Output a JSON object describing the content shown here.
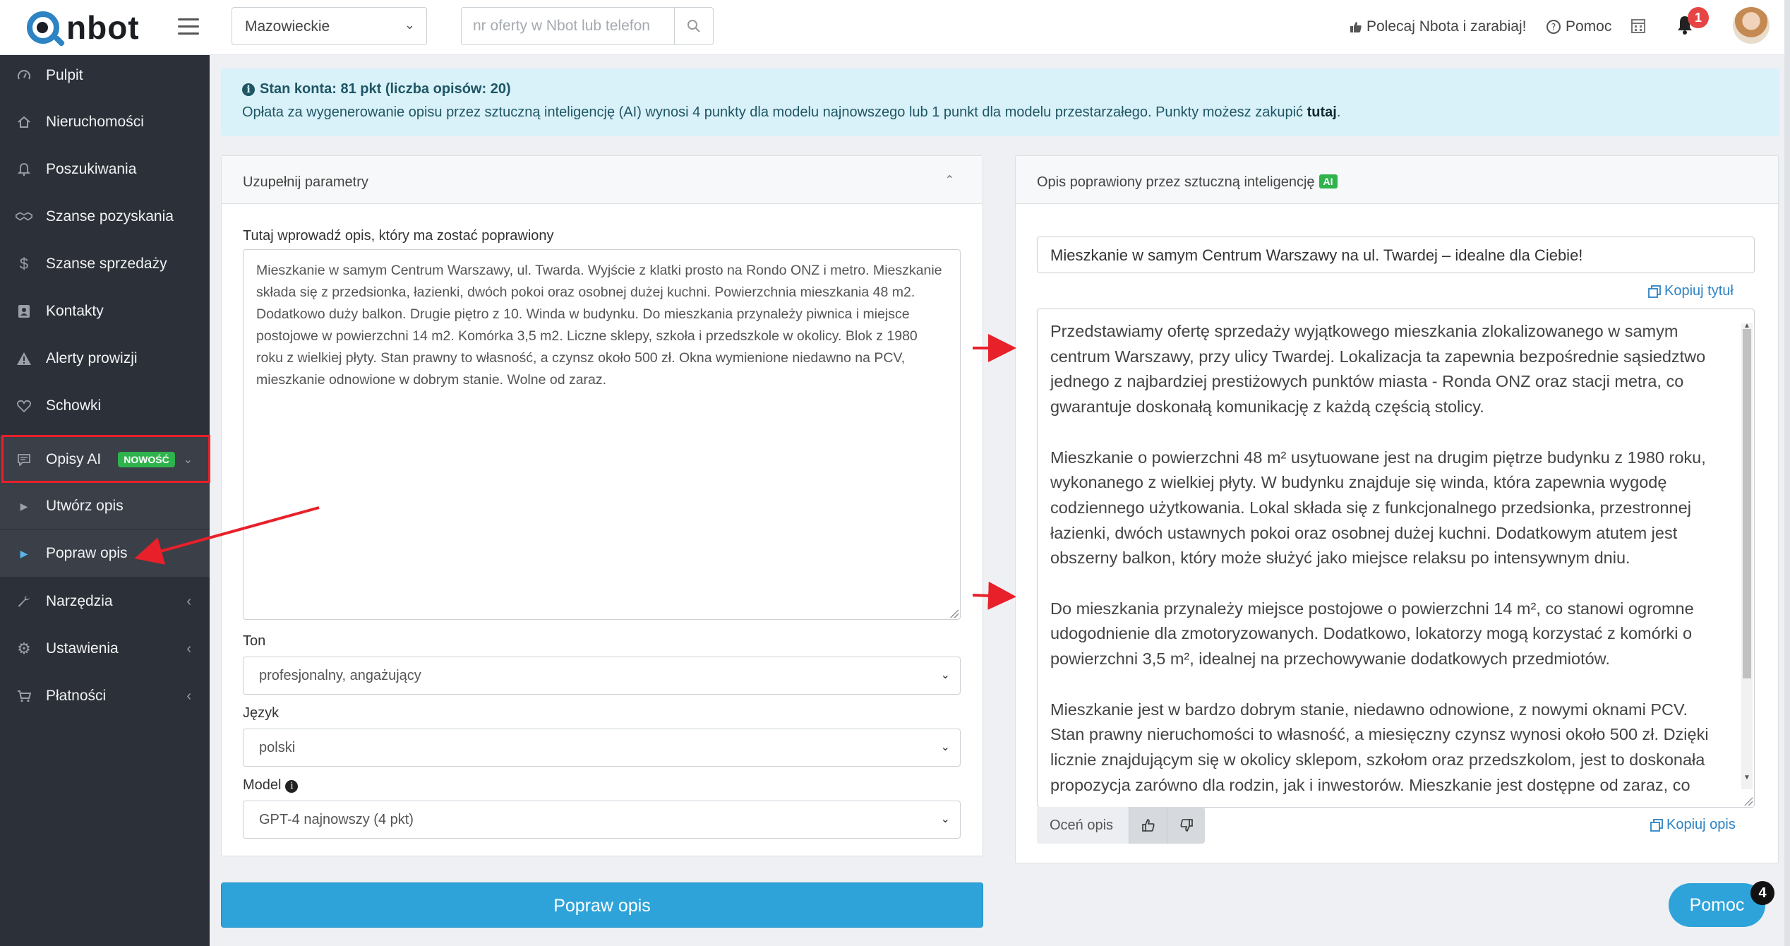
{
  "header": {
    "logo_text": "nbot",
    "region_select": "Mazowieckie",
    "search_placeholder": "nr oferty w Nbot lub telefon",
    "refer_label": "Polecaj Nbota i zarabiaj!",
    "help_label": "Pomoc",
    "notification_count": "1"
  },
  "sidebar": {
    "items": [
      {
        "label": "Pulpit",
        "icon": "dashboard-icon"
      },
      {
        "label": "Nieruchomości",
        "icon": "home-icon"
      },
      {
        "label": "Poszukiwania",
        "icon": "bell-icon"
      },
      {
        "label": "Szanse pozyskania",
        "icon": "handshake-icon"
      },
      {
        "label": "Szanse sprzedaży",
        "icon": "dollar-icon"
      },
      {
        "label": "Kontakty",
        "icon": "contact-icon"
      },
      {
        "label": "Alerty prowizji",
        "icon": "warning-icon"
      },
      {
        "label": "Schowki",
        "icon": "heart-icon"
      },
      {
        "label": "Opisy AI",
        "icon": "comment-icon",
        "badge": "NOWOŚĆ"
      },
      {
        "label": "Utwórz opis",
        "icon": "caret-right-icon"
      },
      {
        "label": "Popraw opis",
        "icon": "caret-right-icon"
      },
      {
        "label": "Narzędzia",
        "icon": "wrench-icon"
      },
      {
        "label": "Ustawienia",
        "icon": "cog-icon"
      },
      {
        "label": "Płatności",
        "icon": "cart-icon"
      }
    ]
  },
  "banner": {
    "title": "Stan konta: 81 pkt (liczba opisów: 20)",
    "text": "Opłata za wygenerowanie opisu przez sztuczną inteligencję (AI) wynosi 4 punkty dla modelu najnowszego lub 1 punkt dla modelu przestarzałego. Punkty możesz zakupić ",
    "link": "tutaj",
    "end": "."
  },
  "left_panel": {
    "title": "Uzupełnij parametry",
    "input_label": "Tutaj wprowadź opis, który ma zostać poprawiony",
    "input_text": "Mieszkanie w samym Centrum Warszawy, ul. Twarda. Wyjście z klatki prosto na Rondo ONZ i metro. Mieszkanie składa się z przedsionka, łazienki, dwóch pokoi oraz osobnej dużej kuchni. Powierzchnia mieszkania 48 m2. Dodatkowo duży balkon. Drugie piętro z 10. Winda w budynku. Do mieszkania przynależy piwnica i miejsce postojowe w powierzchni 14 m2. Komórka 3,5 m2. Liczne sklepy, szkoła i przedszkole w okolicy. Blok z 1980 roku z wielkiej płyty. Stan prawny to własność, a czynsz około 500 zł. Okna wymienione niedawno na PCV, mieszkanie odnowione w dobrym stanie. Wolne od zaraz.",
    "tone_label": "Ton",
    "tone_value": "profesjonalny, angażujący",
    "lang_label": "Język",
    "lang_value": "polski",
    "model_label": "Model",
    "model_value": "GPT-4 najnowszy (4 pkt)"
  },
  "right_panel": {
    "title": "Opis poprawiony przez sztuczną inteligencję",
    "ai_badge": "AI",
    "generated_title": "Mieszkanie w samym Centrum Warszawy na ul. Twardej – idealne dla Ciebie!",
    "copy_title": "Kopiuj tytuł",
    "paragraphs": [
      "Przedstawiamy ofertę sprzedaży wyjątkowego mieszkania zlokalizowanego w samym centrum Warszawy, przy ulicy Twardej. Lokalizacja ta zapewnia bezpośrednie sąsiedztwo jednego z najbardziej prestiżowych punktów miasta - Ronda ONZ oraz stacji metra, co gwarantuje doskonałą komunikację z każdą częścią stolicy.",
      "Mieszkanie o powierzchni 48 m² usytuowane jest na drugim piętrze budynku z 1980 roku, wykonanego z wielkiej płyty. W budynku znajduje się winda, która zapewnia wygodę codziennego użytkowania. Lokal składa się z funkcjonalnego przedsionka, przestronnej łazienki, dwóch ustawnych pokoi oraz osobnej dużej kuchni. Dodatkowym atutem jest obszerny balkon, który może służyć jako miejsce relaksu po intensywnym dniu.",
      "Do mieszkania przynależy miejsce postojowe o powierzchni 14 m², co stanowi ogromne udogodnienie dla zmotoryzowanych. Dodatkowo, lokatorzy mogą korzystać z komórki o powierzchni 3,5 m², idealnej na przechowywanie dodatkowych przedmiotów.",
      "Mieszkanie jest w bardzo dobrym stanie, niedawno odnowione, z nowymi oknami PCV. Stan prawny nieruchomości to własność, a miesięczny czynsz wynosi około 500 zł. Dzięki licznie znajdującym się w okolicy sklepom, szkołom oraz przedszkolom, jest to doskonała propozycja zarówno dla rodzin, jak i inwestorów. Mieszkanie jest dostępne od zaraz, co"
    ],
    "rate_label": "Oceń opis",
    "copy_desc": "Kopiuj opis"
  },
  "actions": {
    "submit": "Popraw opis",
    "help_fab": "Pomoc",
    "help_fab_count": "4"
  },
  "colors": {
    "accent": "#2ea3da",
    "sidebar_bg": "#2c3038",
    "badge_green": "#2fb34d",
    "annotation_red": "#e8202a"
  }
}
